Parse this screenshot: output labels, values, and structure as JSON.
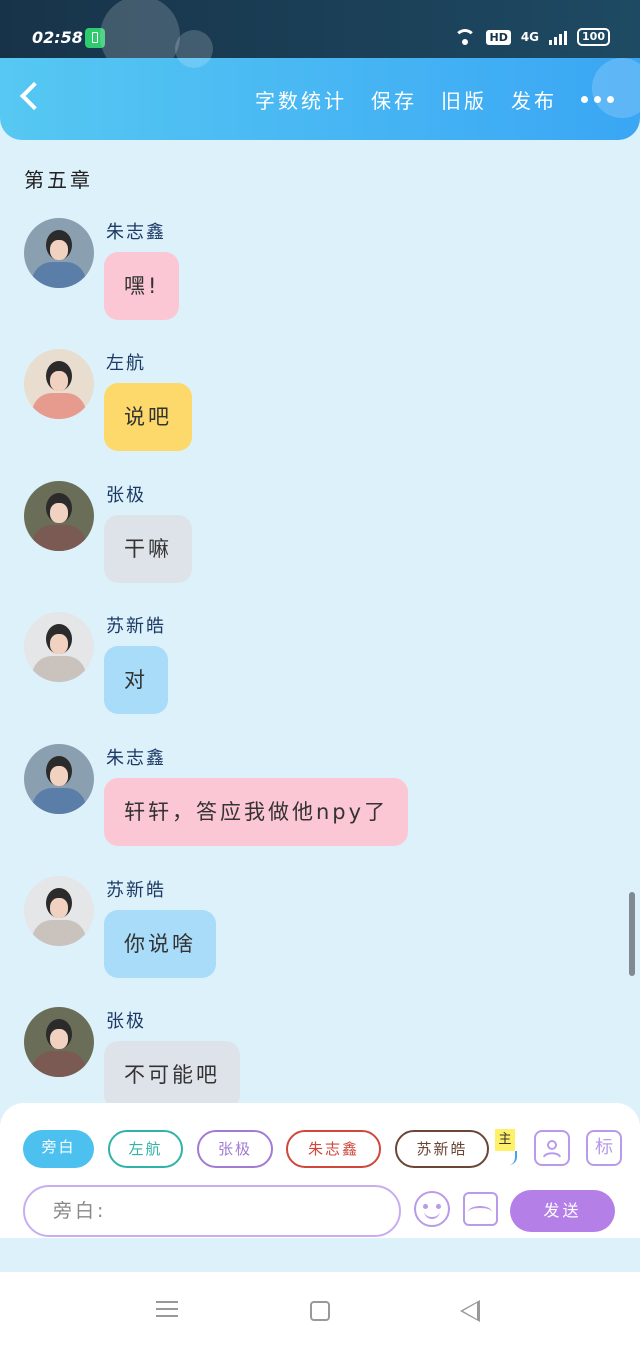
{
  "status_bar": {
    "time": "02:58",
    "network": "4G",
    "hd": "HD",
    "battery": "100"
  },
  "header": {
    "menu": [
      "字数统计",
      "保存",
      "旧版",
      "发布"
    ]
  },
  "chapter_title": "第五章",
  "messages": [
    {
      "name": "朱志鑫",
      "text": "嘿!",
      "bubble_color": "#fcc7d4"
    },
    {
      "name": "左航",
      "text": "说吧",
      "bubble_color": "#fdd96b"
    },
    {
      "name": "张极",
      "text": "干嘛",
      "bubble_color": "#dee3ea"
    },
    {
      "name": "苏新皓",
      "text": "对",
      "bubble_color": "#a8dcf8"
    },
    {
      "name": "朱志鑫",
      "text": "轩轩，答应我做他npy了",
      "bubble_color": "#fcc7d4"
    },
    {
      "name": "苏新皓",
      "text": "你说啥",
      "bubble_color": "#a8dcf8"
    },
    {
      "name": "张极",
      "text": "不可能吧",
      "bubble_color": "#dee3ea"
    }
  ],
  "characters": [
    {
      "label": "旁白",
      "active": true,
      "color": "#4cc0ef"
    },
    {
      "label": "左航",
      "active": false,
      "color": "#2fb3a8"
    },
    {
      "label": "张极",
      "active": false,
      "color": "#a27bd3"
    },
    {
      "label": "朱志鑫",
      "active": false,
      "color": "#d0473c"
    },
    {
      "label": "苏新皓",
      "active": false,
      "color": "#6b4535"
    }
  ],
  "tag_label": "主",
  "mark_button_label": "标",
  "input": {
    "placeholder": "旁白:"
  },
  "send_label": "发送"
}
